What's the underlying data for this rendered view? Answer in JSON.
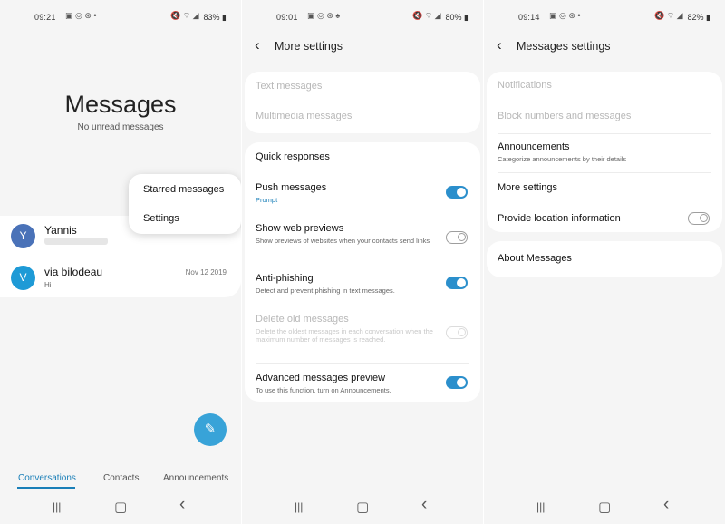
{
  "panel1": {
    "status": {
      "time": "09:21",
      "icons_left": "▣ ◎ ⊛ •",
      "icons_right": "🔇 ⌔ ◢",
      "battery": "83% ▮"
    },
    "title": "Messages",
    "subtitle": "No unread messages",
    "menu": [
      "Starred messages",
      "Settings"
    ],
    "conversations": [
      {
        "initial": "Y",
        "name": "Yannis",
        "preview": "",
        "date": "",
        "color": "#4a72b8"
      },
      {
        "initial": "V",
        "name": "via bilodeau",
        "preview": "Hi",
        "date": "Nov 12 2019",
        "color": "#1e9ad6"
      }
    ],
    "tabs": [
      "Conversations",
      "Contacts",
      "Announcements"
    ]
  },
  "panel2": {
    "status": {
      "time": "09:01",
      "icons_left": "▣ ◎ ⊛ ♠",
      "icons_right": "🔇 ⌔ ◢",
      "battery": "80% ▮"
    },
    "title": "More settings",
    "card1": [
      "Text messages",
      "Multimedia messages"
    ],
    "card2": {
      "quick_responses": "Quick responses",
      "push_label": "Push messages",
      "push_sub": "Prompt",
      "web_label": "Show web previews",
      "web_sub": "Show previews of websites when your contacts send links",
      "phish_label": "Anti-phishing",
      "phish_sub": "Detect and prevent phishing in text messages.",
      "delete_label": "Delete old messages",
      "delete_sub": "Delete the oldest messages in each conversation when the maximum number of messages is reached.",
      "adv_label": "Advanced messages preview",
      "adv_sub": "To use this function, turn on Announcements."
    }
  },
  "panel3": {
    "status": {
      "time": "09:14",
      "icons_left": "▣ ◎ ⊛ •",
      "icons_right": "🔇 ⌔ ◢",
      "battery": "82% ▮"
    },
    "title": "Messages settings",
    "notifications": "Notifications",
    "block": "Block numbers and messages",
    "announcements": "Announcements",
    "announcements_sub": "Categorize announcements by their details",
    "more": "More settings",
    "location": "Provide location information",
    "about": "About Messages"
  },
  "nav": {
    "recents": "|||",
    "home": "▢",
    "back": "‹"
  },
  "icons": {
    "back_arrow": "‹",
    "fab": "✎"
  },
  "colors": {
    "accent": "#1a7fb8",
    "toggle_on": "#2b8fcc",
    "fab": "#38a3d8"
  }
}
